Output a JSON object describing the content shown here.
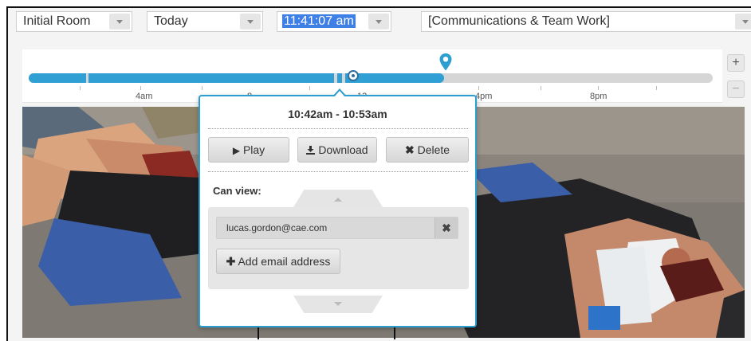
{
  "header": {
    "room_select": "Initial Room",
    "day_select": "Today",
    "time_select": "11:41:07 am",
    "category_select": "[Communications & Team Work]"
  },
  "timeline": {
    "tick_labels": [
      "4am",
      "8",
      "12",
      "4pm",
      "8pm"
    ],
    "zoom_in": "+",
    "zoom_out": "−"
  },
  "popover": {
    "time_range": "10:42am - 10:53am",
    "play_label": "Play",
    "download_label": "Download",
    "delete_label": "Delete",
    "can_view_label": "Can view:",
    "viewers": [
      "lucas.gordon@cae.com"
    ],
    "add_email_label": "Add email address"
  },
  "icons": {
    "play": "play-icon",
    "download": "download-icon",
    "delete": "close-icon",
    "remove": "close-icon",
    "add": "plus-icon",
    "pin": "map-pin-icon"
  },
  "colors": {
    "accent": "#2f9fd4",
    "popover_border": "#2b9fd0",
    "selection": "#3f80e6"
  }
}
